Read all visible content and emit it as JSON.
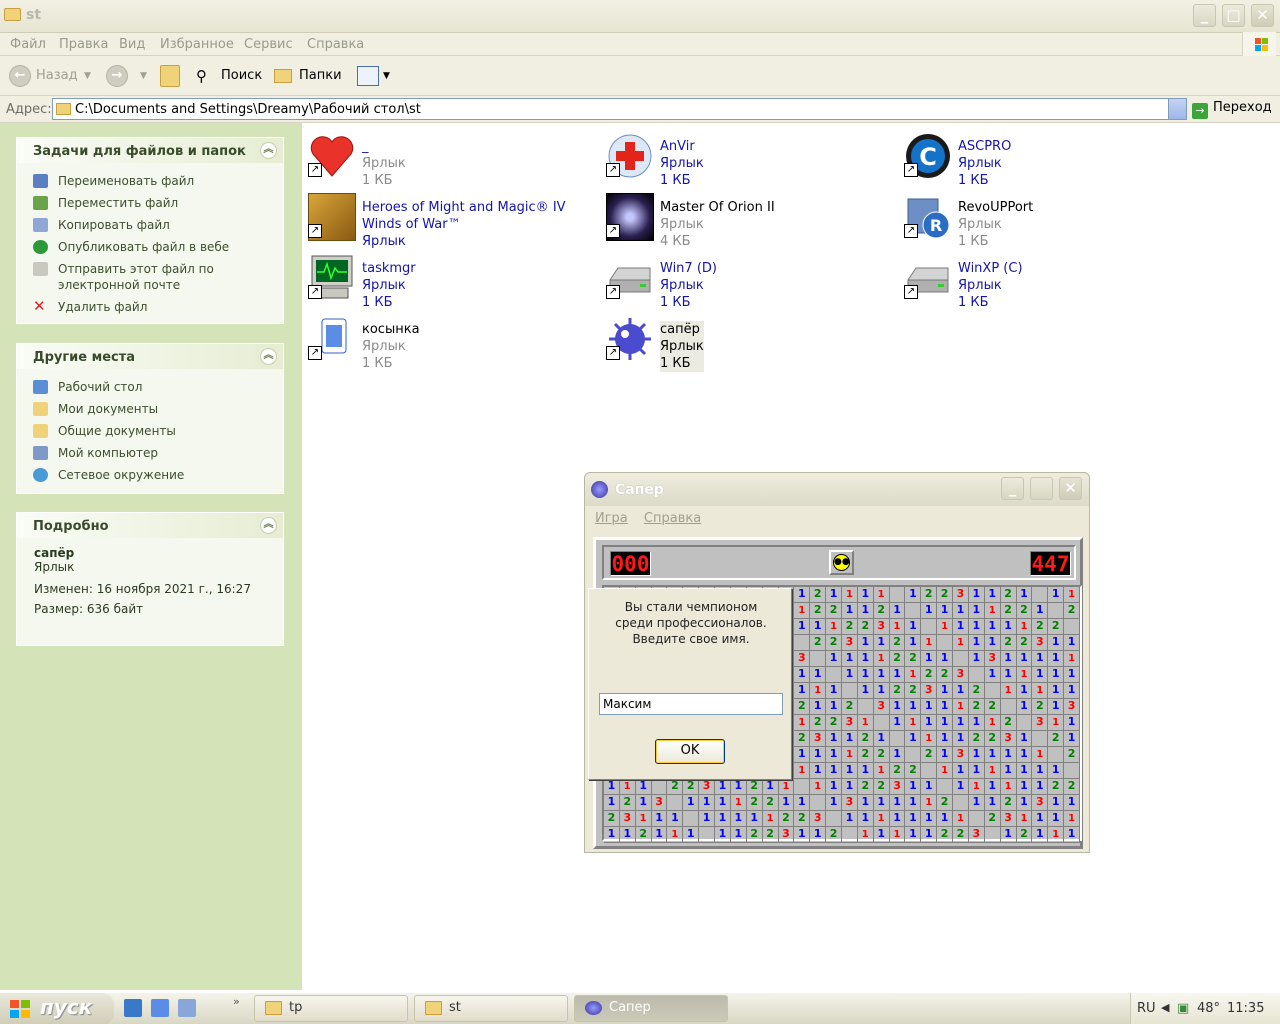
{
  "window": {
    "title": "st"
  },
  "menu": [
    "Файл",
    "Правка",
    "Вид",
    "Избранное",
    "Сервис",
    "Справка"
  ],
  "toolbar": {
    "back": "Назад",
    "search": "Поиск",
    "folders": "Папки"
  },
  "address": {
    "label": "Адрес:",
    "path": "C:\\Documents and Settings\\Dreamy\\Рабочий стол\\st",
    "go": "Переход"
  },
  "tasks_panel": {
    "title": "Задачи для файлов и папок",
    "items": [
      "Переименовать файл",
      "Переместить файл",
      "Копировать файл",
      "Опубликовать файл в вебе",
      "Отправить этот файл по электронной почте",
      "Удалить файл"
    ]
  },
  "places_panel": {
    "title": "Другие места",
    "items": [
      "Рабочий стол",
      "Мои документы",
      "Общие документы",
      "Мой компьютер",
      "Сетевое окружение"
    ]
  },
  "details_panel": {
    "title": "Подробно",
    "name": "сапёр",
    "type": "Ярлык",
    "modified": "Изменен: 16 ноября 2021 г., 16:27",
    "size": "Размер: 636 байт"
  },
  "files": [
    {
      "name": "_",
      "type": "Ярлык",
      "size": "1 КБ",
      "icon": "heart-icon"
    },
    {
      "name": "AnVir",
      "type": "Ярлык",
      "size": "1 КБ",
      "icon": "anvir-icon"
    },
    {
      "name": "ASCPRO",
      "type": "Ярлык",
      "size": "1 КБ",
      "icon": "ascpro-icon"
    },
    {
      "name": "Heroes of Might and Magic® IV Winds of War™",
      "type": "Ярлык",
      "size": "",
      "icon": "heroes-icon"
    },
    {
      "name": "Master Of Orion II",
      "type": "Ярлык",
      "size": "4 КБ",
      "icon": "orion-icon"
    },
    {
      "name": "RevoUPPort",
      "type": "Ярлык",
      "size": "1 КБ",
      "icon": "revo-icon"
    },
    {
      "name": "taskmgr",
      "type": "Ярлык",
      "size": "1 КБ",
      "icon": "taskmgr-icon"
    },
    {
      "name": "Win7 (D)",
      "type": "Ярлык",
      "size": "1 КБ",
      "icon": "drive-icon"
    },
    {
      "name": "WinXP (C)",
      "type": "Ярлык",
      "size": "1 КБ",
      "icon": "drive-icon"
    },
    {
      "name": "косынка",
      "type": "Ярлык",
      "size": "1 КБ",
      "icon": "solitaire-icon"
    },
    {
      "name": "сапёр",
      "type": "Ярлык",
      "size": "1 КБ",
      "icon": "mine-icon"
    }
  ],
  "minesweeper": {
    "title": "Сапер",
    "menu": [
      "Игра",
      "Справка"
    ],
    "mines_counter": "000",
    "timer": "447",
    "dialog": {
      "line1": "Вы стали чемпионом",
      "line2": "среди профессионалов.",
      "line3": "Введите свое имя.",
      "name_value": "Максим",
      "ok": "OK"
    }
  },
  "taskbar": {
    "start": "пуск",
    "tasks": [
      "tp",
      "st",
      "Сапер"
    ],
    "lang": "RU",
    "temp": "48°",
    "clock": "11:35"
  }
}
